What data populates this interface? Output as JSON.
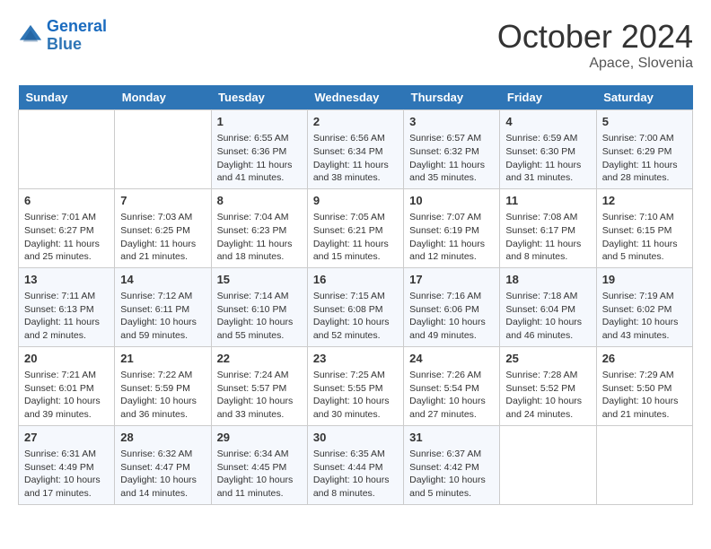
{
  "header": {
    "logo_line1": "General",
    "logo_line2": "Blue",
    "month": "October 2024",
    "location": "Apace, Slovenia"
  },
  "days_of_week": [
    "Sunday",
    "Monday",
    "Tuesday",
    "Wednesday",
    "Thursday",
    "Friday",
    "Saturday"
  ],
  "weeks": [
    [
      {
        "day": "",
        "info": ""
      },
      {
        "day": "",
        "info": ""
      },
      {
        "day": "1",
        "info": "Sunrise: 6:55 AM\nSunset: 6:36 PM\nDaylight: 11 hours and 41 minutes."
      },
      {
        "day": "2",
        "info": "Sunrise: 6:56 AM\nSunset: 6:34 PM\nDaylight: 11 hours and 38 minutes."
      },
      {
        "day": "3",
        "info": "Sunrise: 6:57 AM\nSunset: 6:32 PM\nDaylight: 11 hours and 35 minutes."
      },
      {
        "day": "4",
        "info": "Sunrise: 6:59 AM\nSunset: 6:30 PM\nDaylight: 11 hours and 31 minutes."
      },
      {
        "day": "5",
        "info": "Sunrise: 7:00 AM\nSunset: 6:29 PM\nDaylight: 11 hours and 28 minutes."
      }
    ],
    [
      {
        "day": "6",
        "info": "Sunrise: 7:01 AM\nSunset: 6:27 PM\nDaylight: 11 hours and 25 minutes."
      },
      {
        "day": "7",
        "info": "Sunrise: 7:03 AM\nSunset: 6:25 PM\nDaylight: 11 hours and 21 minutes."
      },
      {
        "day": "8",
        "info": "Sunrise: 7:04 AM\nSunset: 6:23 PM\nDaylight: 11 hours and 18 minutes."
      },
      {
        "day": "9",
        "info": "Sunrise: 7:05 AM\nSunset: 6:21 PM\nDaylight: 11 hours and 15 minutes."
      },
      {
        "day": "10",
        "info": "Sunrise: 7:07 AM\nSunset: 6:19 PM\nDaylight: 11 hours and 12 minutes."
      },
      {
        "day": "11",
        "info": "Sunrise: 7:08 AM\nSunset: 6:17 PM\nDaylight: 11 hours and 8 minutes."
      },
      {
        "day": "12",
        "info": "Sunrise: 7:10 AM\nSunset: 6:15 PM\nDaylight: 11 hours and 5 minutes."
      }
    ],
    [
      {
        "day": "13",
        "info": "Sunrise: 7:11 AM\nSunset: 6:13 PM\nDaylight: 11 hours and 2 minutes."
      },
      {
        "day": "14",
        "info": "Sunrise: 7:12 AM\nSunset: 6:11 PM\nDaylight: 10 hours and 59 minutes."
      },
      {
        "day": "15",
        "info": "Sunrise: 7:14 AM\nSunset: 6:10 PM\nDaylight: 10 hours and 55 minutes."
      },
      {
        "day": "16",
        "info": "Sunrise: 7:15 AM\nSunset: 6:08 PM\nDaylight: 10 hours and 52 minutes."
      },
      {
        "day": "17",
        "info": "Sunrise: 7:16 AM\nSunset: 6:06 PM\nDaylight: 10 hours and 49 minutes."
      },
      {
        "day": "18",
        "info": "Sunrise: 7:18 AM\nSunset: 6:04 PM\nDaylight: 10 hours and 46 minutes."
      },
      {
        "day": "19",
        "info": "Sunrise: 7:19 AM\nSunset: 6:02 PM\nDaylight: 10 hours and 43 minutes."
      }
    ],
    [
      {
        "day": "20",
        "info": "Sunrise: 7:21 AM\nSunset: 6:01 PM\nDaylight: 10 hours and 39 minutes."
      },
      {
        "day": "21",
        "info": "Sunrise: 7:22 AM\nSunset: 5:59 PM\nDaylight: 10 hours and 36 minutes."
      },
      {
        "day": "22",
        "info": "Sunrise: 7:24 AM\nSunset: 5:57 PM\nDaylight: 10 hours and 33 minutes."
      },
      {
        "day": "23",
        "info": "Sunrise: 7:25 AM\nSunset: 5:55 PM\nDaylight: 10 hours and 30 minutes."
      },
      {
        "day": "24",
        "info": "Sunrise: 7:26 AM\nSunset: 5:54 PM\nDaylight: 10 hours and 27 minutes."
      },
      {
        "day": "25",
        "info": "Sunrise: 7:28 AM\nSunset: 5:52 PM\nDaylight: 10 hours and 24 minutes."
      },
      {
        "day": "26",
        "info": "Sunrise: 7:29 AM\nSunset: 5:50 PM\nDaylight: 10 hours and 21 minutes."
      }
    ],
    [
      {
        "day": "27",
        "info": "Sunrise: 6:31 AM\nSunset: 4:49 PM\nDaylight: 10 hours and 17 minutes."
      },
      {
        "day": "28",
        "info": "Sunrise: 6:32 AM\nSunset: 4:47 PM\nDaylight: 10 hours and 14 minutes."
      },
      {
        "day": "29",
        "info": "Sunrise: 6:34 AM\nSunset: 4:45 PM\nDaylight: 10 hours and 11 minutes."
      },
      {
        "day": "30",
        "info": "Sunrise: 6:35 AM\nSunset: 4:44 PM\nDaylight: 10 hours and 8 minutes."
      },
      {
        "day": "31",
        "info": "Sunrise: 6:37 AM\nSunset: 4:42 PM\nDaylight: 10 hours and 5 minutes."
      },
      {
        "day": "",
        "info": ""
      },
      {
        "day": "",
        "info": ""
      }
    ]
  ]
}
